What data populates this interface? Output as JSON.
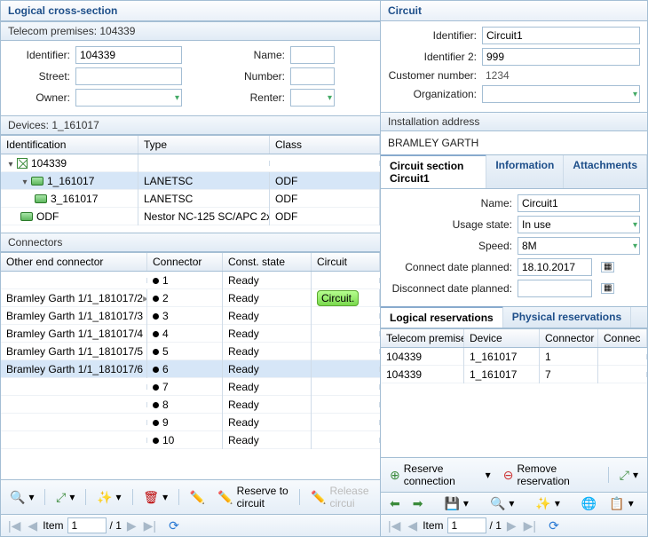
{
  "left": {
    "title": "Logical cross-section",
    "premises_header": "Telecom premises: 104339",
    "form": {
      "labels": {
        "identifier": "Identifier:",
        "name": "Name:",
        "street": "Street:",
        "number": "Number:",
        "owner": "Owner:",
        "renter": "Renter:"
      },
      "identifier": "104339",
      "name": "",
      "street": "",
      "number": "",
      "owner": "",
      "renter": ""
    },
    "devices_header": "Devices: 1_161017",
    "device_cols": {
      "ident": "Identification",
      "type": "Type",
      "class": "Class"
    },
    "device_tree": [
      {
        "indent": 0,
        "expander": "▾",
        "icon": "box",
        "ident": "104339",
        "type": "",
        "class": ""
      },
      {
        "indent": 1,
        "expander": "▾",
        "icon": "dev",
        "ident": "1_161017",
        "type": "LANETSC",
        "class": "ODF",
        "selected": true
      },
      {
        "indent": 2,
        "expander": "",
        "icon": "dev",
        "ident": "3_161017",
        "type": "LANETSC",
        "class": "ODF"
      },
      {
        "indent": 1,
        "expander": "",
        "icon": "dev",
        "ident": "ODF",
        "type": "Nestor NC-125 SC/APC 2x...",
        "class": "ODF"
      }
    ],
    "connectors_header": "Connectors",
    "conn_cols": {
      "other": "Other end connector",
      "conn": "Connector",
      "state": "Const. state",
      "circuit": "Circuit"
    },
    "conn_rows": [
      {
        "other": "",
        "conn": "1",
        "state": "Ready",
        "circuit": ""
      },
      {
        "other": "Bramley Garth 1/1_181017/2",
        "chev": true,
        "conn": "2",
        "state": "Ready",
        "circuit": "Circuit."
      },
      {
        "other": "Bramley Garth 1/1_181017/3",
        "conn": "3",
        "state": "Ready",
        "circuit": ""
      },
      {
        "other": "Bramley Garth 1/1_181017/4",
        "conn": "4",
        "state": "Ready",
        "circuit": ""
      },
      {
        "other": "Bramley Garth 1/1_181017/5",
        "conn": "5",
        "state": "Ready",
        "circuit": ""
      },
      {
        "other": "Bramley Garth 1/1_181017/6",
        "conn": "6",
        "state": "Ready",
        "circuit": "",
        "selected": true
      },
      {
        "other": "",
        "conn": "7",
        "state": "Ready",
        "circuit": ""
      },
      {
        "other": "",
        "conn": "8",
        "state": "Ready",
        "circuit": ""
      },
      {
        "other": "",
        "conn": "9",
        "state": "Ready",
        "circuit": ""
      },
      {
        "other": "",
        "conn": "10",
        "state": "Ready",
        "circuit": ""
      }
    ],
    "toolbar": {
      "reserve": "Reserve to circuit",
      "release": "Release circui"
    },
    "pager": {
      "item_label": "Item",
      "item_value": "1",
      "total": "/ 1"
    }
  },
  "right": {
    "title": "Circuit",
    "form_labels": {
      "identifier": "Identifier:",
      "identifier2": "Identifier 2:",
      "customer": "Customer number:",
      "org": "Organization:"
    },
    "form_values": {
      "identifier": "Circuit1",
      "identifier2": "999",
      "customer": "1234",
      "org": ""
    },
    "install_header": "Installation address",
    "install_value": "BRAMLEY GARTH",
    "tabs1": {
      "section": "Circuit section Circuit1",
      "info": "Information",
      "attach": "Attachments"
    },
    "section_form": {
      "labels": {
        "name": "Name:",
        "usage": "Usage state:",
        "speed": "Speed:",
        "connect": "Connect date planned:",
        "disconnect": "Disconnect date planned:"
      },
      "values": {
        "name": "Circuit1",
        "usage": "In use",
        "speed": "8M",
        "connect": "18.10.2017",
        "disconnect": ""
      }
    },
    "tabs2": {
      "logical": "Logical reservations",
      "physical": "Physical reservations"
    },
    "res_cols": {
      "premises": "Telecom premises",
      "device": "Device",
      "connector": "Connector",
      "connec": "Connec"
    },
    "res_rows": [
      {
        "premises": "104339",
        "device": "1_161017",
        "connector": "1"
      },
      {
        "premises": "104339",
        "device": "1_161017",
        "connector": "7"
      }
    ],
    "res_toolbar": {
      "reserve": "Reserve connection",
      "remove": "Remove reservation"
    },
    "pager": {
      "item_label": "Item",
      "item_value": "1",
      "total": "/ 1"
    }
  }
}
